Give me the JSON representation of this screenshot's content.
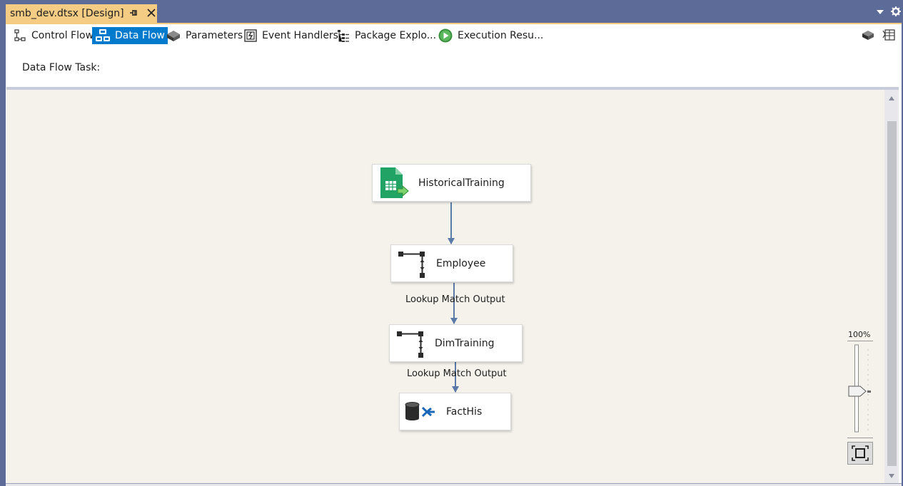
{
  "document_tab": {
    "title": "smb_dev.dtsx [Design]"
  },
  "toolbar": {
    "tabs": [
      {
        "label": "Control Flow",
        "icon": "control-flow-icon",
        "active": false
      },
      {
        "label": "Data Flow",
        "icon": "data-flow-icon",
        "active": true
      },
      {
        "label": "Parameters",
        "icon": "parameters-icon",
        "active": false
      },
      {
        "label": "Event Handlers",
        "icon": "event-handlers-icon",
        "active": false
      },
      {
        "label": "Package Explo...",
        "icon": "package-explorer-icon",
        "active": false
      },
      {
        "label": "Execution Resu...",
        "icon": "execution-results-icon",
        "active": false
      }
    ]
  },
  "task": {
    "label": "Data Flow Task:",
    "value": ""
  },
  "components": [
    {
      "name": "HistoricalTraining",
      "icon": "excel-source-icon"
    },
    {
      "name": "Employee",
      "icon": "lookup-icon"
    },
    {
      "name": "DimTraining",
      "icon": "lookup-icon"
    },
    {
      "name": "FactHis",
      "icon": "ole-db-destination-icon"
    }
  ],
  "connectors": [
    {
      "label": ""
    },
    {
      "label": "Lookup Match Output"
    },
    {
      "label": "Lookup Match Output"
    }
  ],
  "zoom": {
    "label": "100%",
    "value_percent": 100
  },
  "colors": {
    "tab_active": "#f5cc84",
    "toolbar_active": "#007acc",
    "canvas": "#f4f2eb",
    "connector": "#5b7aa8",
    "chrome": "#5d6b99"
  }
}
